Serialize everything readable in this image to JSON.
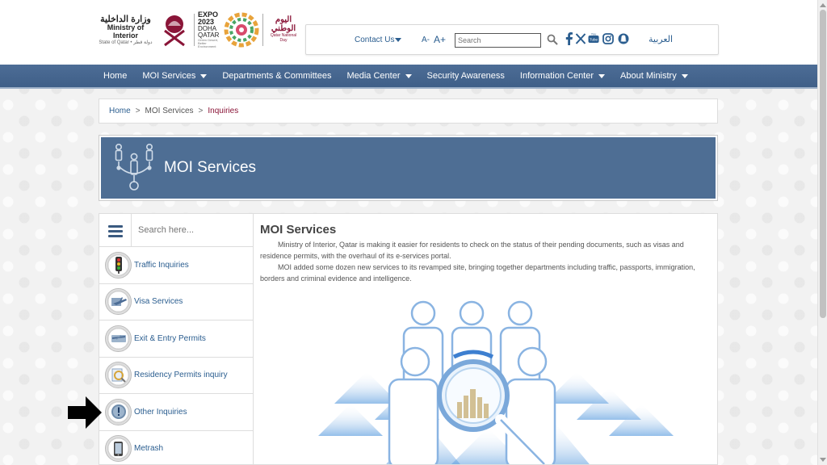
{
  "header": {
    "ministry_ar": "وزارة الداخلية",
    "ministry_en": "Ministry of Interior",
    "state": "State of Qatar • دولة قطر",
    "expo_line1": "EXPO",
    "expo_line2": "2023",
    "expo_line3": "DOHA",
    "expo_line4": "QATAR",
    "expo_tag": "Green Desert, Better Environment",
    "national_day_ar": "اليوم الوطني",
    "national_day_sub": "Qatar National Day"
  },
  "utility": {
    "contact_label": "Contact Us",
    "font_small": "A-",
    "font_large": "A+",
    "search_placeholder": "Search",
    "language_link": "العربية",
    "social_icons": [
      "facebook-icon",
      "x-icon",
      "youtube-icon",
      "instagram-icon",
      "snapchat-icon"
    ]
  },
  "nav": {
    "items": [
      {
        "label": "Home",
        "dropdown": false
      },
      {
        "label": "MOI Services",
        "dropdown": true
      },
      {
        "label": "Departments & Committees",
        "dropdown": false
      },
      {
        "label": "Media Center",
        "dropdown": true
      },
      {
        "label": "Security Awareness",
        "dropdown": false
      },
      {
        "label": "Information Center",
        "dropdown": true
      },
      {
        "label": "About Ministry",
        "dropdown": true
      }
    ]
  },
  "breadcrumb": {
    "home": "Home",
    "sep1": ">",
    "section": "MOI Services",
    "sep2": ">",
    "current": "Inquiries"
  },
  "banner": {
    "title": "MOI Services"
  },
  "sidebar": {
    "search_placeholder": "Search here...",
    "items": [
      {
        "label": "Traffic Inquiries",
        "icon": "traffic-light-icon"
      },
      {
        "label": "Visa Services",
        "icon": "airplane-icon"
      },
      {
        "label": "Exit & Entry Permits",
        "icon": "passport-icon"
      },
      {
        "label": "Residency Permits inquiry",
        "icon": "document-search-icon"
      },
      {
        "label": "Other Inquiries",
        "icon": "info-icon"
      },
      {
        "label": "Metrash",
        "icon": "mobile-icon"
      }
    ]
  },
  "main": {
    "title": "MOI Services",
    "paragraph1": "Ministry of Interior, Qatar is making it easier for residents to check on the status of their pending documents, such as visas and residence permits, with the overhaul of its e-services portal.",
    "paragraph2": "MOI added some dozen new services to its revamped site, bringing together departments including traffic, passports, immigration, borders and criminal evidence and intelligence."
  },
  "colors": {
    "nav_blue": "#4d6d96",
    "link_blue": "#2a5d8f",
    "maroon": "#8a1538",
    "banner_blue": "#4e6e94"
  }
}
